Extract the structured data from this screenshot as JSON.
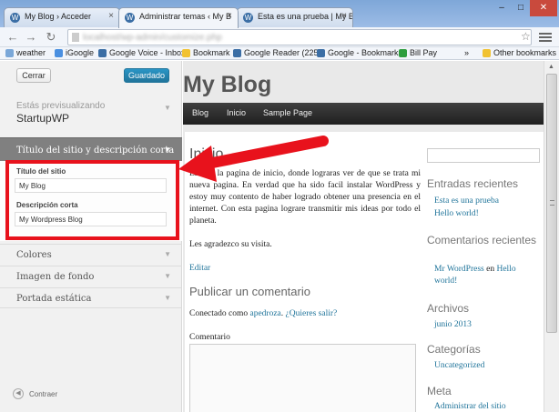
{
  "browser": {
    "tabs": [
      {
        "label": "My Blog › Acceder",
        "active": false
      },
      {
        "label": "Administrar temas ‹ My B",
        "active": true
      },
      {
        "label": "Esta es una prueba | My Bl",
        "active": false
      }
    ],
    "window_controls": {
      "minimize": "–",
      "maximize": "□",
      "close": "✕"
    },
    "address": "localhost/wp-admin/customize.php",
    "bookmarks": [
      {
        "label": "weather",
        "color": "#7aa7d8"
      },
      {
        "label": "iGoogle",
        "color": "#4a8fe0"
      },
      {
        "label": "Google Voice - Inbox",
        "color": "#3b6ea5"
      },
      {
        "label": "Bookmark",
        "color": "#f1c232"
      },
      {
        "label": "Google Reader (225)",
        "color": "#3b6ea5"
      },
      {
        "label": "Google - Bookmarks",
        "color": "#3b6ea5"
      },
      {
        "label": "Bill Pay",
        "color": "#2e9e3e"
      }
    ],
    "overflow": "»",
    "other_bookmarks": "Other bookmarks"
  },
  "customizer": {
    "close_label": "Cerrar",
    "saved_label": "Guardado",
    "previewing_label": "Estás previsualizando",
    "theme_name": "StartupWP",
    "active_section": "Título del sitio y descripción corta",
    "fields": {
      "site_title_label": "Título del sitio",
      "site_title_value": "My Blog",
      "tagline_label": "Descripción corta",
      "tagline_value": "My Wordpress Blog"
    },
    "sections": [
      "Colores",
      "Imagen de fondo",
      "Portada estática"
    ],
    "collapse_label": "Contraer"
  },
  "blog": {
    "title": "My Blog",
    "nav": [
      "Blog",
      "Inicio",
      "Sample Page"
    ],
    "page_title": "Inicio",
    "body": "Esta es la pagina de inicio, donde lograras ver de que se trata mi nueva pagina. En verdad que ha sido facil instalar WordPress y estoy muy contento de haber logrado obtener una presencia en el internet. Con esta pagina lograre transmitir mis ideas por todo el planeta.",
    "visit": "Les agradezco su visita.",
    "edit": "Editar",
    "reply_title": "Publicar un comentario",
    "logged_prefix": "Conectado como",
    "logged_user": "apedroza",
    "logout": "¿Quieres salir?",
    "comment_label": "Comentario",
    "sidebar": {
      "recent_posts_title": "Entradas recientes",
      "recent_posts": [
        "Esta es una prueba",
        "Hello world!"
      ],
      "recent_comments_title": "Comentarios recientes",
      "comment_author": "Mr WordPress",
      "comment_on": "en",
      "comment_post": "Hello world!",
      "archives_title": "Archivos",
      "archive": "junio 2013",
      "categories_title": "Categorías",
      "category": "Uncategorized",
      "meta_title": "Meta",
      "meta_link": "Administrar del sitio"
    }
  },
  "colors": {
    "annotation": "#e8121c",
    "wp_blue": "#21759b",
    "nav_bg": "#2a2a2a"
  }
}
